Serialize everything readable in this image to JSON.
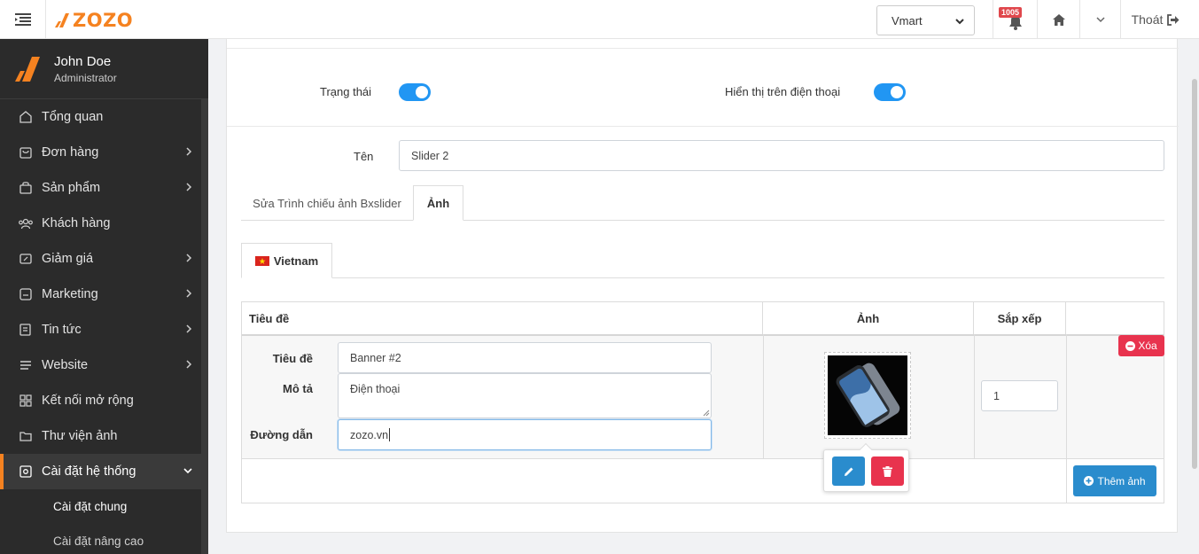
{
  "header": {
    "logo_text": "ZOZO",
    "store": "Vmart",
    "notification_count": "1005",
    "logout": "Thoát"
  },
  "sidebar": {
    "user": {
      "name": "John Doe",
      "role": "Administrator"
    },
    "items": [
      {
        "label": "Tổng quan",
        "icon": "home-icon"
      },
      {
        "label": "Đơn hàng",
        "icon": "cart-icon"
      },
      {
        "label": "Sản phẩm",
        "icon": "bag-icon"
      },
      {
        "label": "Khách hàng",
        "icon": "users-icon"
      },
      {
        "label": "Giảm giá",
        "icon": "coupon-icon"
      },
      {
        "label": "Marketing",
        "icon": "marketing-icon"
      },
      {
        "label": "Tin tức",
        "icon": "news-icon"
      },
      {
        "label": "Website",
        "icon": "menu-icon"
      },
      {
        "label": "Kết nối mở rộng",
        "icon": "grid-icon"
      },
      {
        "label": "Thư viện ảnh",
        "icon": "folder-icon"
      },
      {
        "label": "Cài đặt hệ thống",
        "icon": "settings-icon"
      }
    ],
    "sub_items": [
      {
        "label": "Cài đặt chung"
      },
      {
        "label": "Cài đặt nâng cao"
      }
    ]
  },
  "form": {
    "status_label": "Trạng thái",
    "mobile_label": "Hiển thị trên điện thoại",
    "name_label": "Tên",
    "name_value": "Slider 2",
    "tabs": [
      {
        "label": "Sửa Trình chiếu ảnh Bxslider"
      },
      {
        "label": "Ảnh"
      }
    ],
    "language_tab": "Vietnam"
  },
  "table": {
    "headers": {
      "title": "Tiêu đề",
      "image": "Ảnh",
      "sort": "Sắp xếp"
    },
    "row": {
      "title_label": "Tiêu đề",
      "title_value": "Banner #2",
      "desc_label": "Mô tả",
      "desc_value": "Điện thoại",
      "link_label": "Đường dẫn",
      "link_value": "zozo.vn",
      "sort_value": "1",
      "delete_label": "Xóa"
    },
    "add_label": "Thêm ảnh"
  },
  "colors": {
    "accent": "#f58220",
    "toggle": "#2196f3",
    "danger": "#e8334e",
    "primary": "#2a8ccd",
    "sidebar_bg": "#2b2b2b"
  }
}
